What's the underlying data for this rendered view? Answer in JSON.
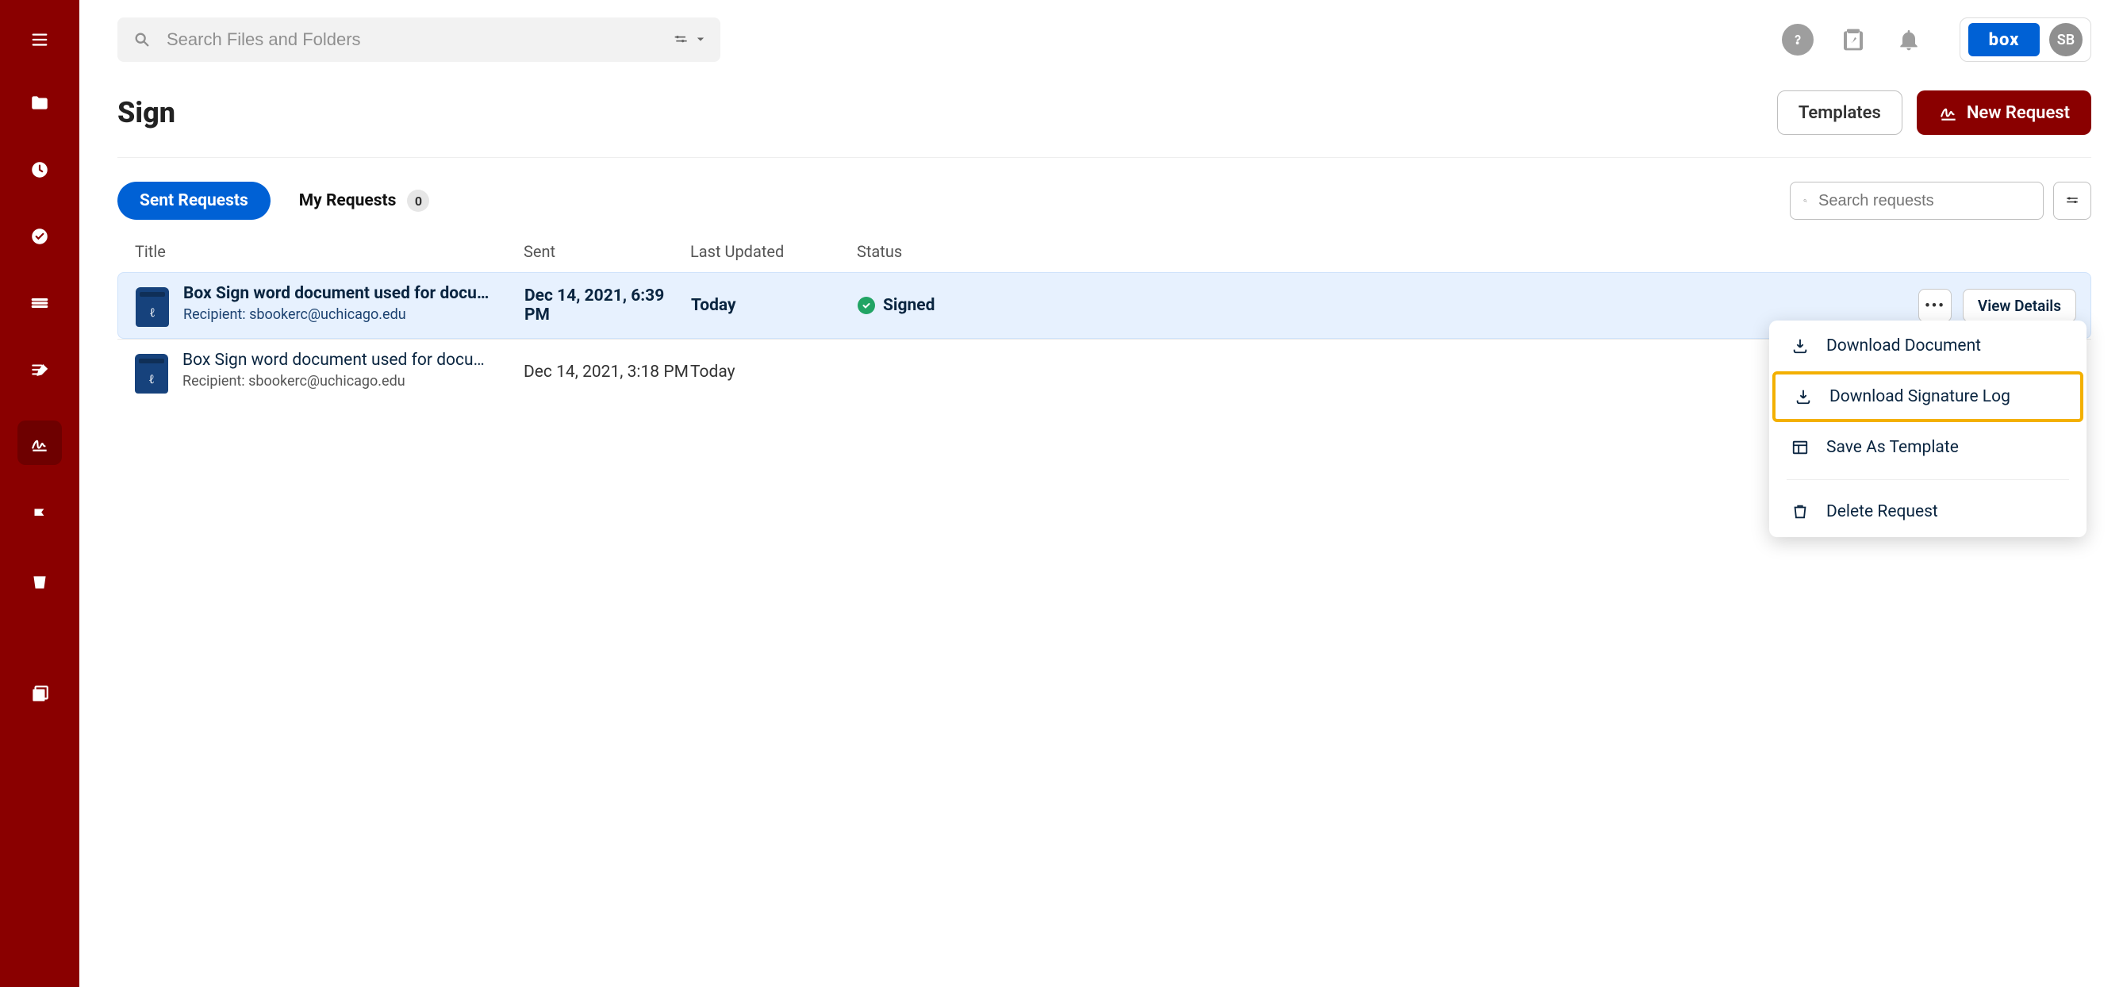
{
  "search": {
    "placeholder": "Search Files and Folders"
  },
  "account": {
    "initials": "SB"
  },
  "page": {
    "title": "Sign"
  },
  "buttons": {
    "templates": "Templates",
    "new_request": "New Request",
    "view_details": "View Details"
  },
  "tabs": {
    "sent": "Sent Requests",
    "my": "My Requests",
    "my_count": "0"
  },
  "requests_search": {
    "placeholder": "Search requests"
  },
  "columns": {
    "title": "Title",
    "sent": "Sent",
    "updated": "Last Updated",
    "status": "Status"
  },
  "rows": [
    {
      "title": "Box Sign word document used for docu…",
      "recipient": "Recipient: sbookerc@uchicago.edu",
      "sent": "Dec 14, 2021, 6:39 PM",
      "updated": "Today",
      "status": "Signed",
      "highlighted": true
    },
    {
      "title": "Box Sign word document used for docu…",
      "recipient": "Recipient: sbookerc@uchicago.edu",
      "sent": "Dec 14, 2021, 3:18 PM",
      "updated": "Today",
      "status": "",
      "highlighted": false
    }
  ],
  "menu": {
    "download_doc": "Download Document",
    "download_log": "Download Signature Log",
    "save_template": "Save As Template",
    "delete": "Delete Request"
  }
}
